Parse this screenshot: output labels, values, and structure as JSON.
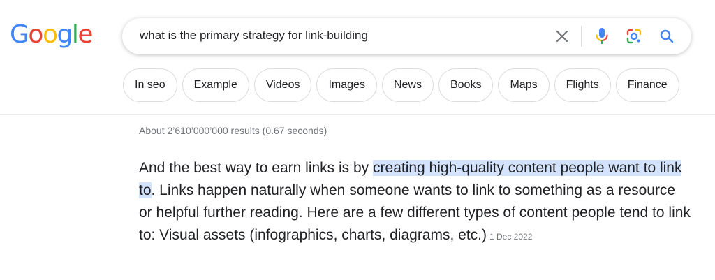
{
  "logo": {
    "letters": [
      "G",
      "o",
      "o",
      "g",
      "l",
      "e"
    ],
    "colors": [
      "#4285F4",
      "#EA4335",
      "#FBBC05",
      "#4285F4",
      "#34A853",
      "#EA4335"
    ]
  },
  "search": {
    "query": "what is the primary strategy for link-building",
    "icons": [
      "close-icon",
      "microphone-icon",
      "lens-icon",
      "search-icon"
    ]
  },
  "chips": [
    "In seo",
    "Example",
    "Videos",
    "Images",
    "News",
    "Books",
    "Maps",
    "Flights",
    "Finance"
  ],
  "results": {
    "stats": "About 2’610’000’000 results (0.67 seconds)"
  },
  "snippet": {
    "before": "And the best way to earn links is by ",
    "highlight": "creating high-quality content people want to link to",
    "after": ". Links happen naturally when someone wants to link to something as a resource or helpful further reading. Here are a few different types of content people tend to link to: Visual assets (infographics, charts, diagrams, etc.)",
    "date": "1 Dec 2022"
  },
  "colors": {
    "highlight": "#d3e3fd",
    "search_icon": "#4285F4",
    "text": "#202124",
    "muted": "#70757a"
  }
}
